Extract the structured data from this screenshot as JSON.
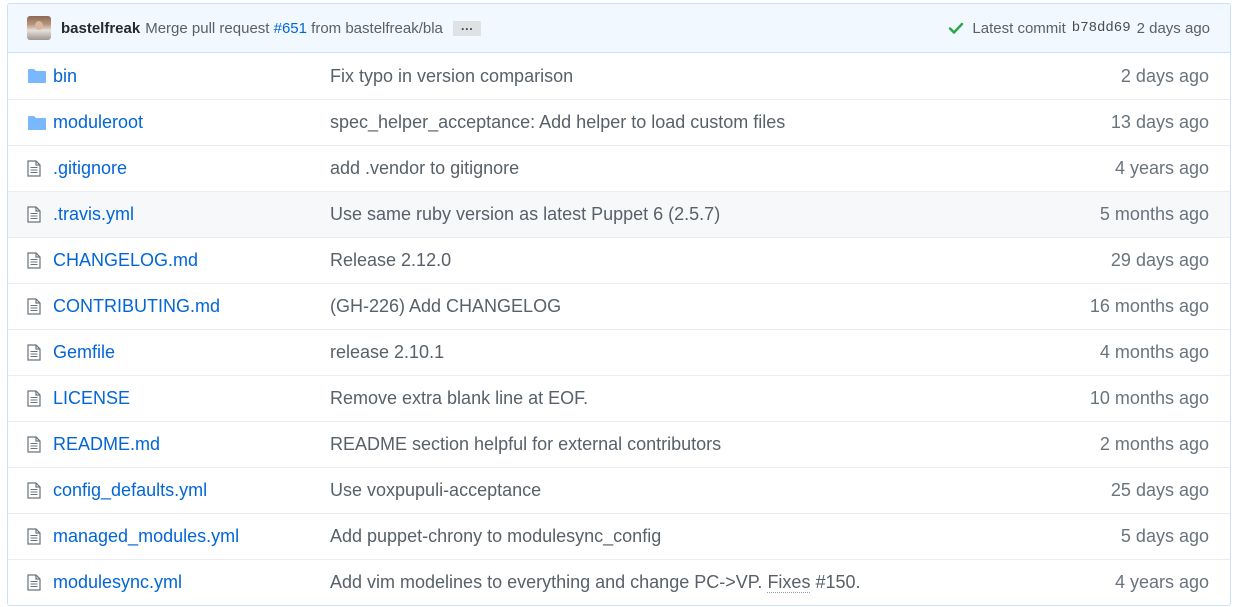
{
  "commit": {
    "author": "bastelfreak",
    "message_prefix": "Merge pull request",
    "pr_number": "#651",
    "message_suffix": "from bastelfreak/bla",
    "more_label": "…",
    "latest_label": "Latest commit",
    "sha": "b78dd69",
    "age": "2 days ago",
    "status_color": "#28a745"
  },
  "files": [
    {
      "name": "bin",
      "type": "folder",
      "message": "Fix typo in version comparison",
      "age": "2 days ago"
    },
    {
      "name": "moduleroot",
      "type": "folder",
      "message": "spec_helper_acceptance: Add helper to load custom files",
      "age": "13 days ago"
    },
    {
      "name": ".gitignore",
      "type": "file",
      "message": "add .vendor to gitignore",
      "age": "4 years ago"
    },
    {
      "name": ".travis.yml",
      "type": "file",
      "message": "Use same ruby version as latest Puppet 6 (2.5.7)",
      "age": "5 months ago"
    },
    {
      "name": "CHANGELOG.md",
      "type": "file",
      "message": "Release 2.12.0",
      "age": "29 days ago"
    },
    {
      "name": "CONTRIBUTING.md",
      "type": "file",
      "message": "(GH-226) Add CHANGELOG",
      "age": "16 months ago"
    },
    {
      "name": "Gemfile",
      "type": "file",
      "message": "release 2.10.1",
      "age": "4 months ago"
    },
    {
      "name": "LICENSE",
      "type": "file",
      "message": "Remove extra blank line at EOF.",
      "age": "10 months ago"
    },
    {
      "name": "README.md",
      "type": "file",
      "message": "README section helpful for external contributors",
      "age": "2 months ago"
    },
    {
      "name": "config_defaults.yml",
      "type": "file",
      "message": "Use voxpupuli-acceptance",
      "age": "25 days ago"
    },
    {
      "name": "managed_modules.yml",
      "type": "file",
      "message": "Add puppet-chrony to modulesync_config",
      "age": "5 days ago"
    },
    {
      "name": "modulesync.yml",
      "type": "file",
      "message": "Add vim modelines to everything and change PC->VP.",
      "message_link": "Fixes",
      "message_issue": "#150.",
      "age": "4 years ago"
    }
  ]
}
